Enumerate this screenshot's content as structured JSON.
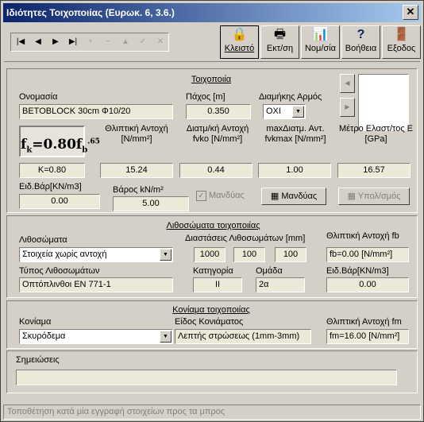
{
  "window": {
    "title": "Ιδιότητες Τοιχοποιίας (Ευρωκ. 6, 3.6.)",
    "close": "✕"
  },
  "toolbar": {
    "nav": [
      "|◀",
      "◀",
      "▶",
      "▶|",
      "+",
      "−",
      "▲",
      "✓",
      "✕"
    ],
    "buttons": [
      {
        "label": "Κλειστό",
        "icon": "🔒"
      },
      {
        "label": "Εκτ/ση",
        "icon": "🖶"
      },
      {
        "label": "Νομ/σία",
        "icon": "📊"
      },
      {
        "label": "Βοήθεια",
        "icon": "?"
      },
      {
        "label": "Εξοδος",
        "icon": "🚪"
      }
    ]
  },
  "wall": {
    "section_title": "Τοιχοποιία",
    "name_label": "Ονομασία",
    "name_value": "BETOBLOCK 30cm Φ10/20",
    "thickness_label": "Πάχος [m]",
    "thickness_value": "0.350",
    "joint_label": "Διαμήκης Αρμός",
    "joint_value": "ΟΧΙ",
    "formula": "fk=0.80fb^0.65",
    "fk_label": "Θλιπτική Αντοχή [N/mm²]",
    "fvko_label": "Διατμ/κή Αντοχή fvko [N/mm²]",
    "fvkmax_label": "maxΔιατμ. Αντ. fvkmax [N/mm²]",
    "e_label": "Μέτρο Ελαστ/τος E [GPa]",
    "k_value": "K=0.80",
    "fk_value": "15.24",
    "fvko_value": "0.44",
    "fvkmax_value": "1.00",
    "e_value": "16.57",
    "weight_label": "Ειδ.Βάρ[KN/m3]",
    "weight_value": "0.00",
    "load_label": "Βάρος kN/m²",
    "load_value": "5.00",
    "mandyas_check_label": "Μανδύας",
    "mandyas_button": "Μανδύας",
    "calc_button": "Υπολ/σμός"
  },
  "units": {
    "section_title": "Λιθοσώματα τοιχοποιίας",
    "type_label": "Λιθοσώματα",
    "type_value": "Στοιχεία χωρίς αντοχή",
    "dims_label": "Διαστάσεις Λιθοσωμάτων [mm]",
    "dims": [
      "1000",
      "100",
      "100"
    ],
    "fb_label": "Θλιπτική Αντοχή fb",
    "fb_value": "fb=0.00 [N/mm²]",
    "kind_label": "Τύπος Λιθοσωμάτων",
    "kind_value": "Οπτόπλινθοι EN 771-1",
    "category_label": "Κατηγορία",
    "category_value": "II",
    "group_label": "Ομάδα",
    "group_value": "2α",
    "weight_label": "Ειδ.Βάρ[KN/m3]",
    "weight_value": "0.00"
  },
  "mortar": {
    "section_title": "Κονίαμα τοιχοποιίας",
    "type_label": "Κονίαμα",
    "type_value": "Σκυρόδεμα",
    "kind_label": "Είδος Κονιάματος",
    "kind_value": "Λεπτής στρώσεως (1mm-3mm)",
    "fm_label": "Θλιπτική Αντοχή fm",
    "fm_value": "fm=16.00 [N/mm²]"
  },
  "notes": {
    "label": "Σημειώσεις",
    "value": ""
  },
  "status": "Τοποθέτηση κατά μία εγγραφή στοιχείων προς τα μπρος",
  "colors": {
    "title_start": "#0a246a",
    "title_end": "#a6caf0",
    "face": "#d4d0c8",
    "field": "#ece9d8"
  }
}
